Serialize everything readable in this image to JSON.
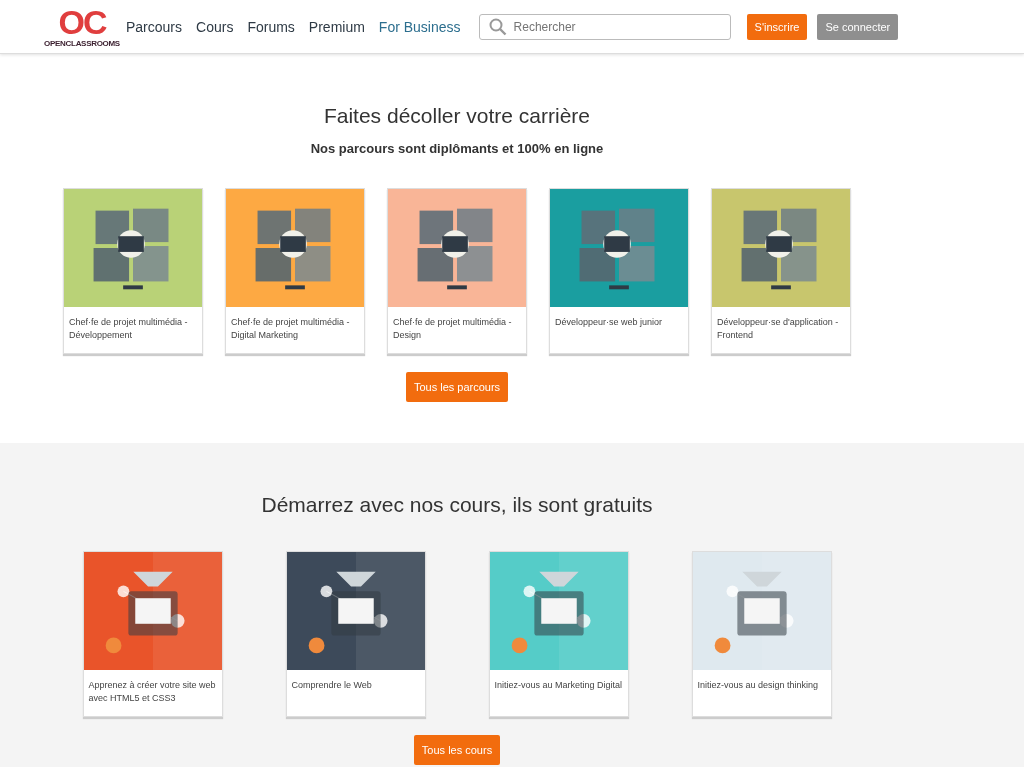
{
  "header": {
    "logo": {
      "mark": "OC",
      "wordmark": "OPENCLASSROOMS"
    },
    "nav": [
      {
        "label": "Parcours",
        "kind": "plain"
      },
      {
        "label": "Cours",
        "kind": "plain"
      },
      {
        "label": "Forums",
        "kind": "plain"
      },
      {
        "label": "Premium",
        "kind": "plain"
      },
      {
        "label": "For Business",
        "kind": "accent"
      }
    ],
    "search": {
      "placeholder": "Rechercher"
    },
    "buttons": [
      {
        "label": "S'inscrire",
        "kind": "primary"
      },
      {
        "label": "Se connecter",
        "kind": "secondary"
      }
    ]
  },
  "paths_section": {
    "title": "Faites décoller votre carrière",
    "subtitle": "Nos parcours sont diplômants et 100% en ligne",
    "cards": [
      {
        "title": "Chef·fe de projet multimédia - Développement"
      },
      {
        "title": "Chef·fe de projet multimédia - Digital Marketing"
      },
      {
        "title": "Chef·fe de projet multimédia - Design"
      },
      {
        "title": "Développeur·se web junior"
      },
      {
        "title": "Développeur·se d'application - Frontend"
      }
    ],
    "button": "Tous les parcours"
  },
  "courses_section": {
    "title": "Démarrez avec nos cours, ils sont gratuits",
    "cards": [
      {
        "title": "Apprenez à créer votre site web avec HTML5 et CSS3"
      },
      {
        "title": "Comprendre le Web"
      },
      {
        "title": "Initiez-vous au Marketing Digital"
      },
      {
        "title": "Initiez-vous au design thinking"
      }
    ],
    "button": "Tous les cours"
  }
}
